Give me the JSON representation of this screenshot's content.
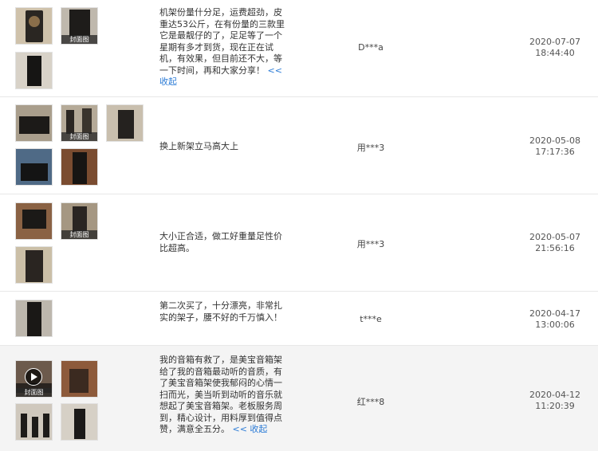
{
  "cover_tag": "封面图",
  "collapse_label": "<< 收起",
  "reviews": [
    {
      "text": "机架份量什分足，运费超劲，皮重达53公斤，在有份量的三款里它是最靓仔的了，足足等了一个星期有多才到货，现在正在试机，有效果，但目前还不大，等一下时间，再和大家分享！",
      "user": "D***a",
      "date": "2020-07-07",
      "time": "18:44:40"
    },
    {
      "text": "换上新架立马高大上",
      "user": "用***3",
      "date": "2020-05-08",
      "time": "17:17:36"
    },
    {
      "text": "大小正合适，做工好重量足性价比超高。",
      "user": "用***3",
      "date": "2020-05-07",
      "time": "21:56:16"
    },
    {
      "text": "第二次买了，十分漂亮，非常扎实的架子，腰不好的千万慎入！",
      "user": "t***e",
      "date": "2020-04-17",
      "time": "13:00:06"
    },
    {
      "text": "我的音箱有救了，是美宝音箱架给了我的音箱最动听的音质，有了美宝音箱架使我郁闷的心情一扫而光，美当听到动听的音乐就想起了美宝音箱架。老板服务周到，精心设计，用料厚到值得点赞，满意全五分。",
      "user": "红***8",
      "date": "2020-04-12",
      "time": "11:20:39"
    }
  ]
}
